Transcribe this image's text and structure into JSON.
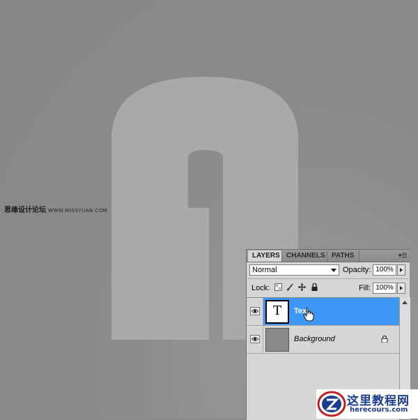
{
  "watermark": {
    "site_cn": "思缘设计论坛",
    "site_url": "WWW.MISSYUAN.COM"
  },
  "layers_panel": {
    "tabs": [
      {
        "label": "LAYERS",
        "active": true
      },
      {
        "label": "CHANNELS",
        "active": false
      },
      {
        "label": "PATHS",
        "active": false
      }
    ],
    "blend_mode": "Normal",
    "opacity_label": "Opacity:",
    "opacity_value": "100%",
    "lock_label": "Lock:",
    "fill_label": "Fill:",
    "fill_value": "100%",
    "layers": [
      {
        "name": "Text",
        "type": "text",
        "thumb_glyph": "T",
        "selected": true,
        "visible": true
      },
      {
        "name": "Background",
        "type": "background",
        "selected": false,
        "visible": true,
        "locked": true
      }
    ]
  },
  "logo": {
    "cn": "这里教程网",
    "en": "herecours.com"
  },
  "colors": {
    "canvas": "#8a8a8a",
    "letter": "#a9a9a9",
    "selected_layer": "#3d97f7",
    "logo_blue": "#1b3d8f",
    "logo_red": "#c0201e"
  }
}
